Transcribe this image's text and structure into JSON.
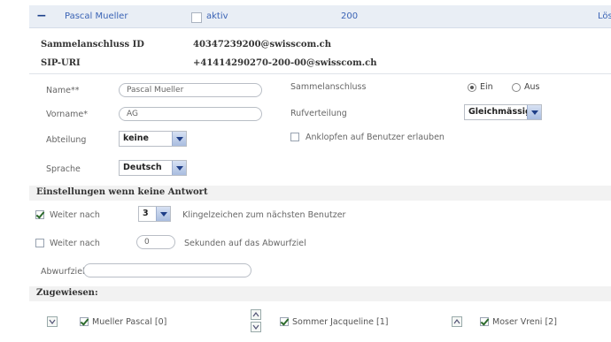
{
  "header": {
    "collapse_symbol": "−",
    "user_name": "Pascal Mueller",
    "active_label": "aktiv",
    "number": "200",
    "delete_label": "Lös"
  },
  "info": {
    "hunt_group_id_label": "Sammelanschluss ID",
    "hunt_group_id_value": "40347239200@swisscom.ch",
    "sip_uri_label": "SIP-URI",
    "sip_uri_value": "+41414290270-200-00@swisscom.ch"
  },
  "form": {
    "name_label": "Name**",
    "name_value": "Pascal Mueller",
    "firstname_label": "Vorname*",
    "firstname_value": "AG",
    "department_label": "Abteilung",
    "department_value": "keine",
    "language_label": "Sprache",
    "language_value": "Deutsch",
    "hunt_group_label": "Sammelanschluss",
    "radio_on_label": "Ein",
    "radio_off_label": "Aus",
    "distribution_label": "Rufverteilung",
    "distribution_value": "Gleichmässig",
    "knock_label": "Anklopfen auf Benutzer erlauben"
  },
  "no_answer": {
    "section_title": "Einstellungen wenn keine Antwort",
    "forward1_label": "Weiter nach",
    "forward1_value": "3",
    "forward1_suffix": "Klingelzeichen zum nächsten Benutzer",
    "forward2_label": "Weiter nach",
    "forward2_value": "0",
    "forward2_suffix": "Sekunden auf das Abwurfziel",
    "target_label": "Abwurfziel"
  },
  "assigned": {
    "section_title": "Zugewiesen:",
    "members": [
      {
        "name": "Mueller Pascal [0]"
      },
      {
        "name": "Sommer Jacqueline [1]"
      },
      {
        "name": "Moser Vreni [2]"
      }
    ]
  }
}
